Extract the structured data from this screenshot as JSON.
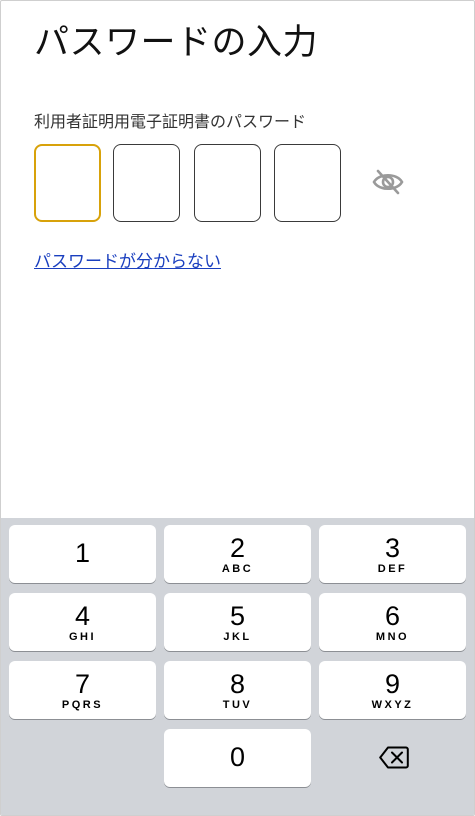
{
  "page": {
    "title": "パスワードの入力",
    "field_label": "利用者証明用電子証明書のパスワード",
    "forgot_link": "パスワードが分からない"
  },
  "pin": {
    "length": 4,
    "active_index": 0,
    "visibility_icon": "eye-slash-icon",
    "active_border_color": "#d8a20a"
  },
  "keypad": {
    "keys": [
      {
        "digit": "1",
        "letters": ""
      },
      {
        "digit": "2",
        "letters": "ABC"
      },
      {
        "digit": "3",
        "letters": "DEF"
      },
      {
        "digit": "4",
        "letters": "GHI"
      },
      {
        "digit": "5",
        "letters": "JKL"
      },
      {
        "digit": "6",
        "letters": "MNO"
      },
      {
        "digit": "7",
        "letters": "PQRS"
      },
      {
        "digit": "8",
        "letters": "TUV"
      },
      {
        "digit": "9",
        "letters": "WXYZ"
      },
      {
        "digit": "0",
        "letters": ""
      }
    ],
    "delete_icon": "backspace-icon",
    "background_color": "#d1d4d9"
  },
  "colors": {
    "link": "#1a3fbf",
    "text": "#111111"
  }
}
